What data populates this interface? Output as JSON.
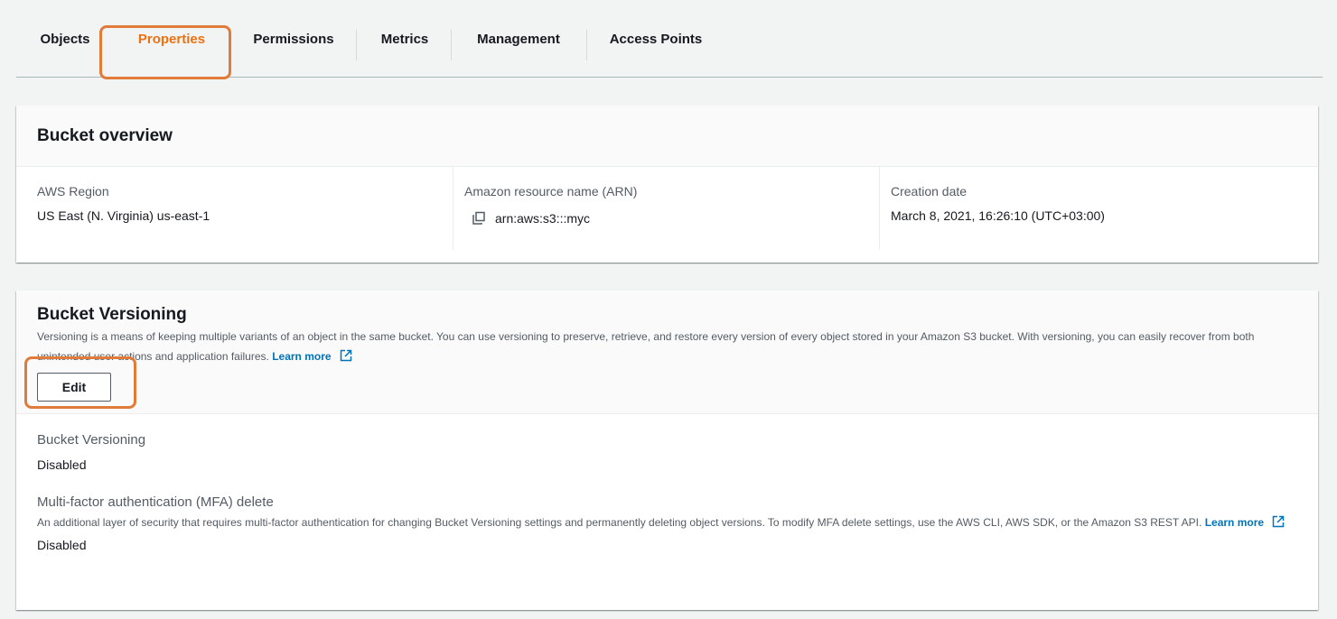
{
  "tabs": [
    {
      "label": "Objects",
      "active": false
    },
    {
      "label": "Properties",
      "active": true
    },
    {
      "label": "Permissions",
      "active": false
    },
    {
      "label": "Metrics",
      "active": false
    },
    {
      "label": "Management",
      "active": false
    },
    {
      "label": "Access Points",
      "active": false
    }
  ],
  "overview": {
    "title": "Bucket overview",
    "region_label": "AWS Region",
    "region_value": "US East (N. Virginia) us-east-1",
    "arn_label": "Amazon resource name (ARN)",
    "arn_value": "arn:aws:s3:::myc",
    "creation_label": "Creation date",
    "creation_value": "March 8, 2021, 16:26:10 (UTC+03:00)"
  },
  "versioning": {
    "title": "Bucket Versioning",
    "description": "Versioning is a means of keeping multiple variants of an object in the same bucket. You can use versioning to preserve, retrieve, and restore every version of every object stored in your Amazon S3 bucket. With versioning, you can easily recover from both unintended user actions and application failures.",
    "learn_more": "Learn more",
    "edit_label": "Edit",
    "status_label": "Bucket Versioning",
    "status_value": "Disabled",
    "mfa_label": "Multi-factor authentication (MFA) delete",
    "mfa_description": "An additional layer of security that requires multi-factor authentication for changing Bucket Versioning settings and permanently deleting object versions. To modify MFA delete settings, use the AWS CLI, AWS SDK, or the Amazon S3 REST API.",
    "mfa_learn_more": "Learn more",
    "mfa_value": "Disabled"
  },
  "colors": {
    "accent": "#ec7211",
    "link": "#0073bb",
    "highlight": "#e07b39"
  },
  "icons": [
    "copy-icon",
    "external-link-icon"
  ]
}
